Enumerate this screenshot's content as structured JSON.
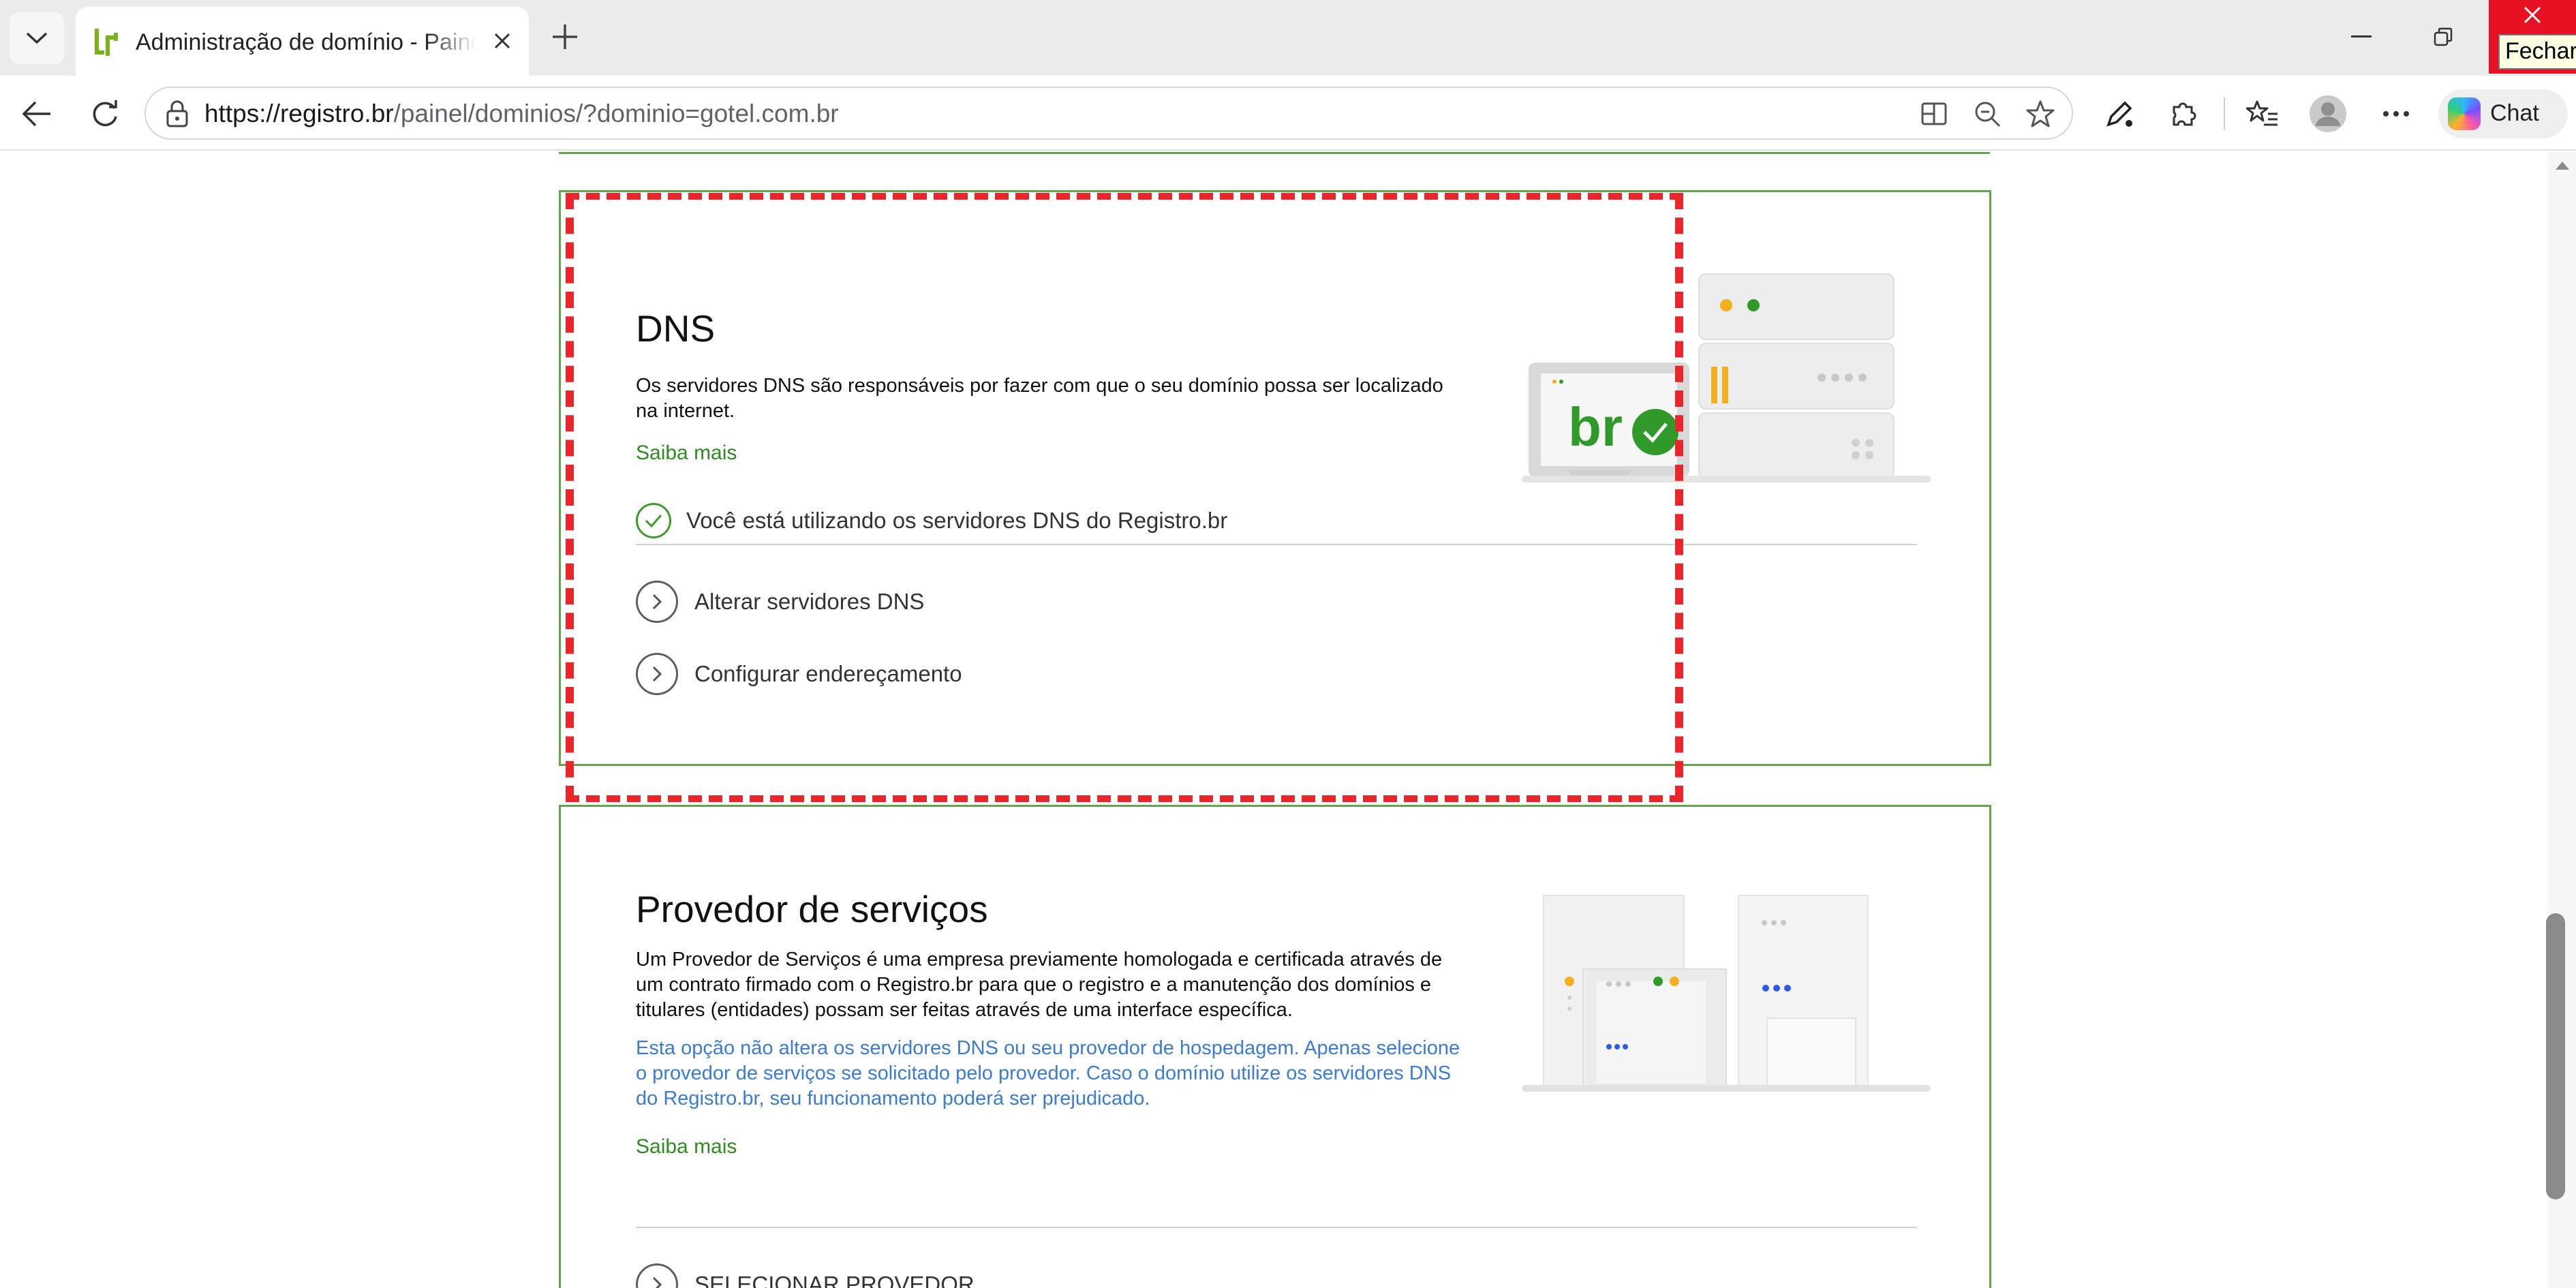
{
  "browser": {
    "tab": {
      "title": "Administração de domínio - Painel"
    },
    "tooltip": "Fechar",
    "url": {
      "host": "https://registro.br",
      "path": "/painel/dominios/?dominio=gotel.com.br"
    },
    "chat_label": "Chat"
  },
  "dns": {
    "title": "DNS",
    "description": "Os servidores DNS são responsáveis por fazer com que o seu domínio possa ser localizado na internet.",
    "more_link": "Saiba mais",
    "status": "Você está utilizando os servidores DNS do Registro.br",
    "actions": [
      {
        "label": "Alterar servidores DNS"
      },
      {
        "label": "Configurar endereçamento"
      }
    ],
    "logo_text": "br"
  },
  "provider": {
    "title": "Provedor de serviços",
    "description": "Um Provedor de Serviços é uma empresa previamente homologada e certificada através de um contrato firmado com o Registro.br para que o registro e a manutenção dos domínios e titulares (entidades) possam ser feitas através de uma interface específica.",
    "note": "Esta opção não altera os servidores DNS ou seu provedor de hospedagem. Apenas selecione o provedor de serviços se solicitado pelo provedor. Caso o domínio utilize os servidores DNS do Registro.br, seu funcionamento poderá ser prejudicado.",
    "more_link": "Saiba mais",
    "actions": [
      {
        "label": "SELECIONAR PROVEDOR"
      }
    ]
  },
  "colors": {
    "brand_green": "#61a64a",
    "link_green": "#2f8a1f",
    "note_blue": "#3a7bd5",
    "highlight_red": "#e8262c",
    "close_red": "#e81123"
  }
}
